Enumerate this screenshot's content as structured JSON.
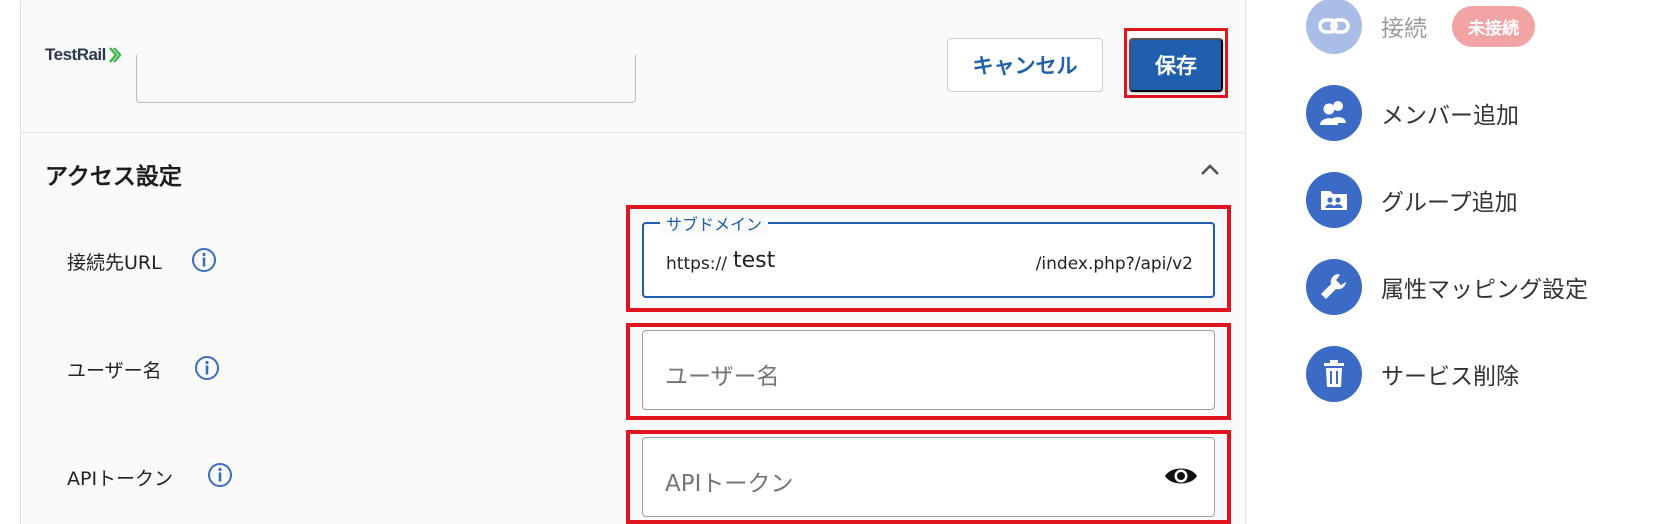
{
  "header": {
    "logo_text": "TestRail",
    "cancel_label": "キャンセル",
    "save_label": "保存"
  },
  "section": {
    "title": "アクセス設定"
  },
  "fields": {
    "url": {
      "label": "接続先URL",
      "floating_label": "サブドメイン",
      "prefix": "https://",
      "value": "test",
      "suffix": "/index.php?/api/v2"
    },
    "username": {
      "label": "ユーザー名",
      "placeholder": "ユーザー名"
    },
    "api_token": {
      "label": "APIトークン",
      "placeholder": "APIトークン"
    }
  },
  "side_menu": {
    "connect": {
      "label": "接続",
      "badge": "未接続"
    },
    "add_member": {
      "label": "メンバー追加"
    },
    "add_group": {
      "label": "グループ追加"
    },
    "attr_mapping": {
      "label": "属性マッピング設定"
    },
    "delete_service": {
      "label": "サービス削除"
    }
  },
  "colors": {
    "primary": "#1f5fae",
    "highlight": "#e0141e",
    "menu_icon": "#3b6bc4",
    "badge": "#f2a4a4"
  },
  "icons": [
    "testrail-logo-icon",
    "chevron-up-icon",
    "info-icon",
    "eye-icon",
    "link-icon",
    "people-icon",
    "group-folder-icon",
    "wrench-icon",
    "trash-icon"
  ]
}
